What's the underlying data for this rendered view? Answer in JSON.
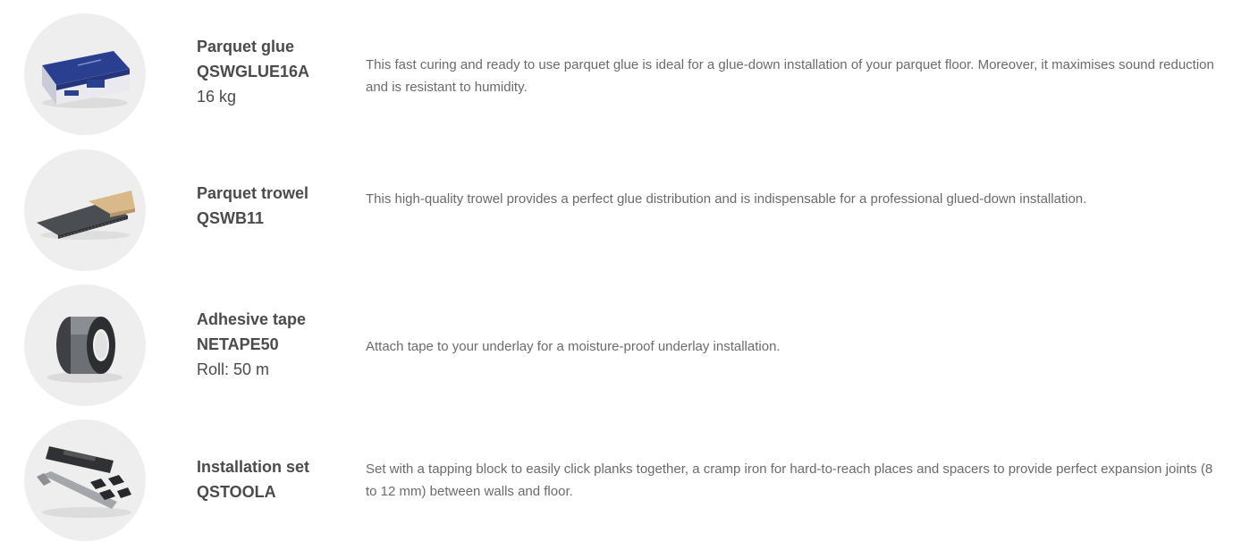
{
  "products": [
    {
      "name": "Parquet glue",
      "code": "QSWGLUE16A",
      "detail": "16 kg",
      "description": "This fast curing and ready to use parquet glue is ideal for a glue-down installation of your parquet floor. Moreover, it maximises sound reduction and is resistant to humidity.",
      "image_icon": "glue-bucket-icon"
    },
    {
      "name": "Parquet trowel",
      "code": "QSWB11",
      "detail": "",
      "description": "This high-quality trowel provides a perfect glue distribution and is indispensable for a professional glued-down installation.",
      "image_icon": "trowel-icon"
    },
    {
      "name": "Adhesive tape",
      "code": "NETAPE50",
      "detail": "Roll: 50 m",
      "description": "Attach tape to your underlay for a moisture-proof underlay installation.",
      "image_icon": "tape-roll-icon"
    },
    {
      "name": "Installation set",
      "code": "QSTOOLA",
      "detail": "",
      "description": "Set with a tapping block to easily click planks together, a cramp iron for hard-to-reach places and spacers to provide perfect expansion joints (8 to 12 mm) between walls and floor.",
      "image_icon": "tool-set-icon"
    }
  ]
}
